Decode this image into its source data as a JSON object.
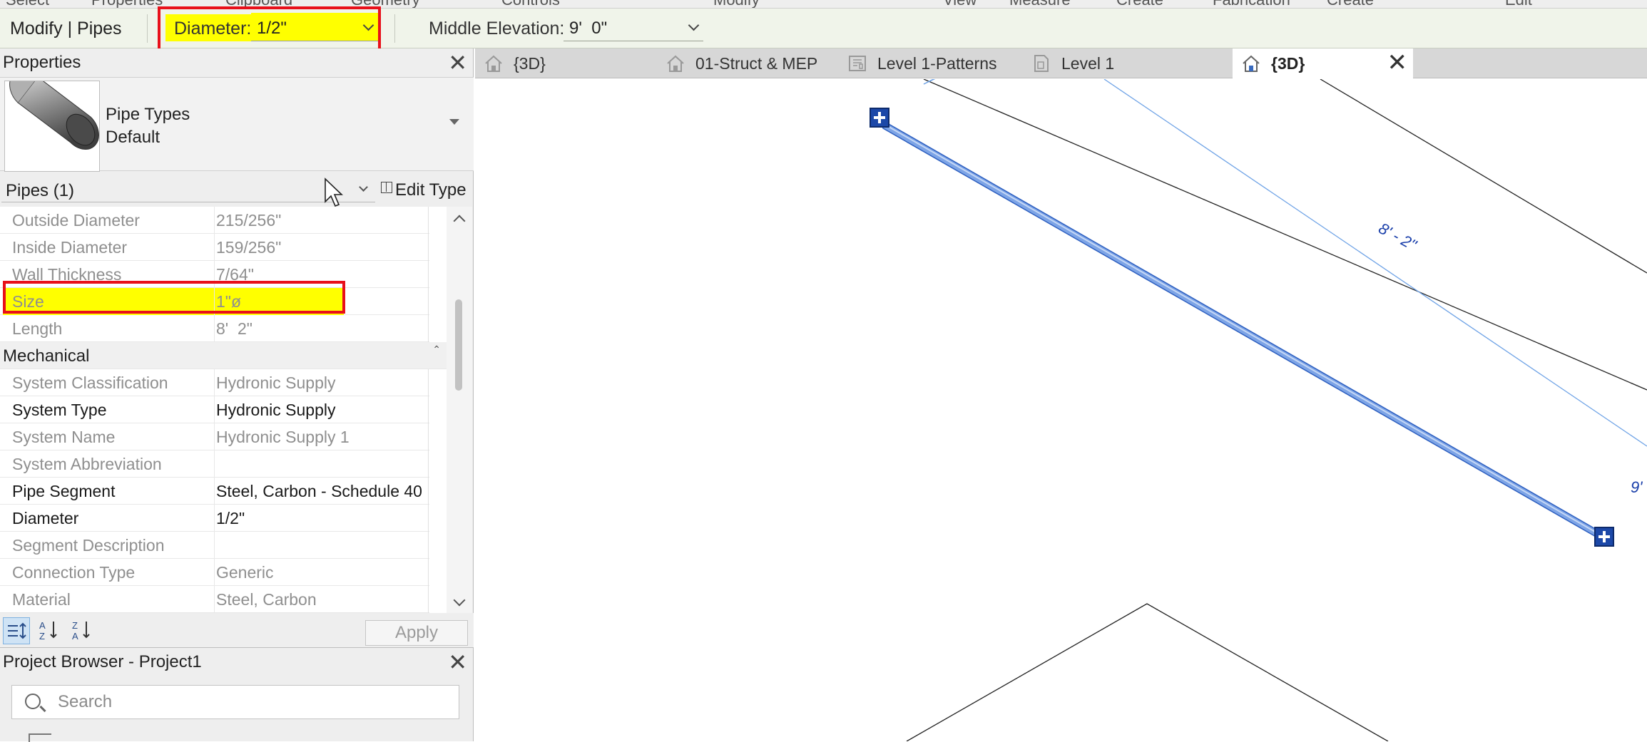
{
  "ribbon": {
    "tabs": [
      "Select",
      "Properties",
      "Clipboard",
      "Geometry",
      "Controls",
      "Modify",
      "View",
      "Measure",
      "Create",
      "Fabrication",
      "Create",
      "Edit"
    ]
  },
  "options_bar": {
    "context": "Modify | Pipes",
    "diameter_label": "Diameter:",
    "diameter_value": "1/2\"",
    "middle_elevation_label": "Middle Elevation:",
    "middle_elevation_value": "9'  0\""
  },
  "properties": {
    "title": "Properties",
    "type_family": "Pipe Types",
    "type_name": "Default",
    "filter_label": "Pipes (1)",
    "edit_type_label": "Edit Type",
    "rows": [
      {
        "name": "Outside Diameter",
        "value": "215/256\""
      },
      {
        "name": "Inside Diameter",
        "value": "159/256\""
      },
      {
        "name": "Wall Thickness",
        "value": "7/64\""
      },
      {
        "name": "Size",
        "value": "1\"ø"
      },
      {
        "name": "Length",
        "value": "8'  2\""
      }
    ],
    "group_mechanical": "Mechanical",
    "mech_rows": [
      {
        "name": "System Classification",
        "value": "Hydronic Supply"
      },
      {
        "name": "System Type",
        "value": "Hydronic Supply"
      },
      {
        "name": "System Name",
        "value": "Hydronic Supply 1"
      },
      {
        "name": "System Abbreviation",
        "value": ""
      },
      {
        "name": "Pipe Segment",
        "value": "Steel, Carbon - Schedule 40"
      },
      {
        "name": "Diameter",
        "value": "1/2\""
      },
      {
        "name": "Segment Description",
        "value": ""
      },
      {
        "name": "Connection Type",
        "value": "Generic"
      },
      {
        "name": "Material",
        "value": "Steel, Carbon"
      }
    ],
    "apply_label": "Apply"
  },
  "project_browser": {
    "title": "Project Browser - Project1",
    "search_placeholder": "Search"
  },
  "view_tabs": [
    {
      "label": "{3D}",
      "icon": "home-3d-icon"
    },
    {
      "label": "01-Struct & MEP",
      "icon": "home-3d-icon"
    },
    {
      "label": "Level 1-Patterns",
      "icon": "sheet-icon"
    },
    {
      "label": "Level 1",
      "icon": "floor-plan-icon"
    },
    {
      "label": "{3D}",
      "icon": "home-3d-icon",
      "active": true
    }
  ],
  "canvas": {
    "dimension_label": "8' - 2\"",
    "dimension_label_partial": "9'"
  },
  "colors": {
    "highlight": "#ffff00",
    "annotation_red": "#e8101a",
    "pipe_blue": "#5b86d6",
    "dimension_blue": "#1a3faa",
    "options_bar_bg": "#f0f4ea"
  }
}
